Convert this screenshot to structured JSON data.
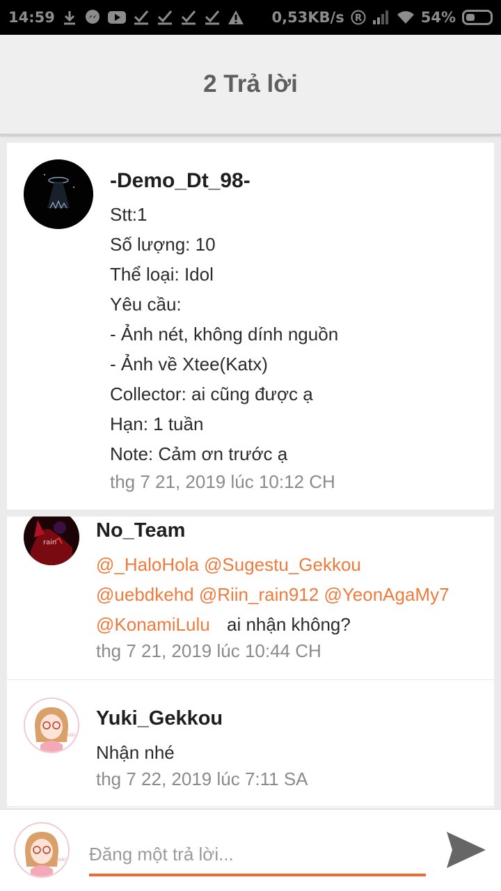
{
  "status_bar": {
    "time": "14:59",
    "network_speed": "0,53KB/s",
    "battery": "54%",
    "icons": [
      "download-icon",
      "messenger-icon",
      "youtube-icon",
      "check-icon",
      "check-icon",
      "check-icon",
      "check-icon",
      "warning-icon",
      "roaming-icon",
      "signal-icon",
      "wifi-icon",
      "battery-icon"
    ]
  },
  "header": {
    "title": "2 Trả lời"
  },
  "post": {
    "username": "-Demo_Dt_98-",
    "lines": [
      "Stt:1",
      "Số lượng: 10",
      "Thể loại: Idol",
      "Yêu cầu:",
      "- Ảnh nét, không dính nguồn",
      "- Ảnh về Xtee(Katx)",
      "Collector: ai cũng được ạ",
      "Hạn: 1 tuần",
      "Note: Cảm ơn trước ạ"
    ],
    "timestamp": "thg 7 21, 2019 lúc 10:12 CH"
  },
  "replies": [
    {
      "username": "No_Team",
      "mentions_line1": "@_HaloHola @Sugestu_Gekkou",
      "mentions_line2": "@uebdkehd @Riin_rain912 @YeonAgaMy7",
      "mentions_line3": "@KonamiLulu",
      "text_after": "ai nhận không?",
      "timestamp": "thg 7 21, 2019 lúc 10:44 CH"
    },
    {
      "username": "Yuki_Gekkou",
      "text": "Nhận nhé",
      "timestamp": "thg 7 22, 2019 lúc 7:11 SA"
    }
  ],
  "composer": {
    "placeholder": "Đăng một trả lời...",
    "send_icon": "send-icon"
  },
  "colors": {
    "accent": "#f06a35",
    "mention": "#f07a3c"
  }
}
